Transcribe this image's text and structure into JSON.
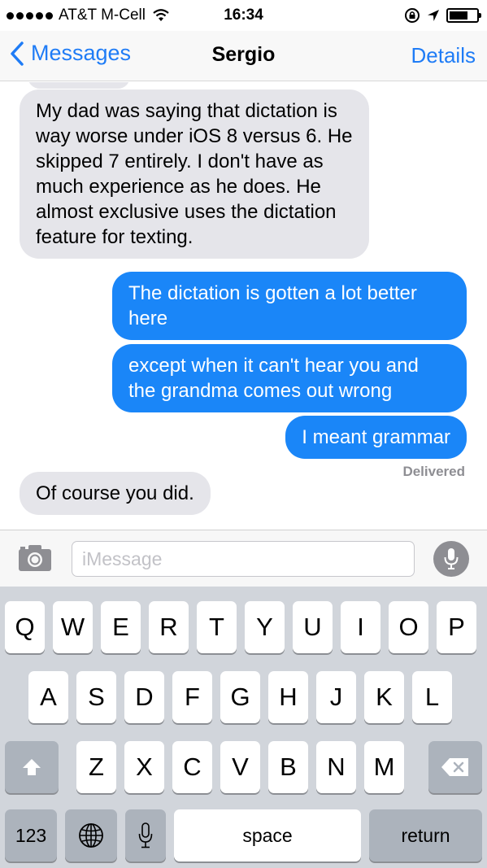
{
  "status_bar": {
    "carrier": "AT&T M-Cell",
    "time": "16:34",
    "icons": [
      "signal-dots-icon",
      "wifi-icon",
      "rotation-lock-icon",
      "location-icon",
      "battery-icon"
    ]
  },
  "nav": {
    "back_label": "Messages",
    "title": "Sergio",
    "details_label": "Details"
  },
  "messages": [
    {
      "direction": "incoming",
      "text": "My dad was saying that dictation is way worse under iOS 8 versus 6. He skipped 7 entirely. I don't have as much experience as he does. He almost exclusive uses the dictation feature for texting."
    },
    {
      "direction": "outgoing",
      "text": "The dictation is gotten a lot better here"
    },
    {
      "direction": "outgoing",
      "text": "except when it can't hear you and the grandma comes out wrong"
    },
    {
      "direction": "outgoing",
      "text": "I meant grammar"
    },
    {
      "direction": "incoming",
      "text": "Of course you did."
    }
  ],
  "delivered_label": "Delivered",
  "compose": {
    "placeholder": "iMessage",
    "value": ""
  },
  "keyboard": {
    "row1": [
      "Q",
      "W",
      "E",
      "R",
      "T",
      "Y",
      "U",
      "I",
      "O",
      "P"
    ],
    "row2": [
      "A",
      "S",
      "D",
      "F",
      "G",
      "H",
      "J",
      "K",
      "L"
    ],
    "row3": [
      "Z",
      "X",
      "C",
      "V",
      "B",
      "N",
      "M"
    ],
    "numbers_label": "123",
    "space_label": "space",
    "return_label": "return"
  },
  "colors": {
    "accent": "#1f7cf6",
    "outgoing_bubble": "#1a86f8",
    "incoming_bubble": "#e5e5ea",
    "keyboard_bg": "#d1d5db"
  }
}
